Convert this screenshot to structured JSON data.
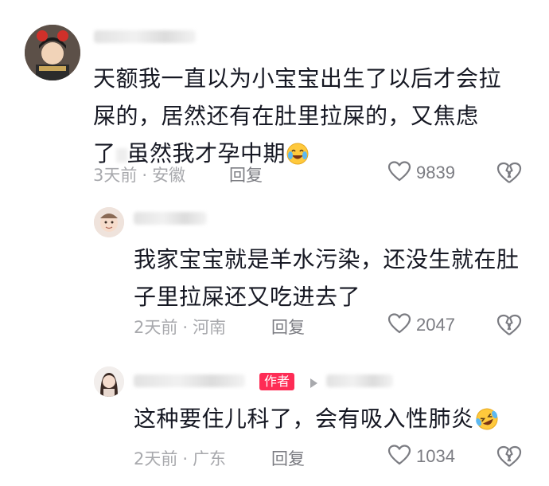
{
  "comments": [
    {
      "text_line1": "天额我一直以为小宝宝出生了以后才会拉",
      "text_line2": "屎的，居然还有在肚里拉屎的，又焦虑",
      "text_line3a": "了",
      "text_line3b": "虽然我才孕中期",
      "time": "3天前",
      "location": "安徽",
      "reply_label": "回复",
      "likes": "9839"
    },
    {
      "text_line1": "我家宝宝就是羊水污染，还没生就在肚",
      "text_line2": "子里拉屎还又吃进去了",
      "time": "2天前",
      "location": "河南",
      "reply_label": "回复",
      "likes": "2047"
    },
    {
      "author_badge": "作者",
      "text_line1": "这种要住儿科了，会有吸入性肺炎",
      "time": "2天前",
      "location": "广东",
      "reply_label": "回复",
      "likes": "1034"
    }
  ],
  "meta_separator": "·",
  "colors": {
    "text": "#161823",
    "meta": "#a8a9ad",
    "action": "#7b7c82",
    "author_badge": "#fe2c55"
  },
  "icons": {
    "like": "heart-outline-icon",
    "dislike": "broken-heart-icon",
    "emoji_1": "tears-of-joy-emoji",
    "emoji_2": "rolling-laughing-emoji"
  }
}
